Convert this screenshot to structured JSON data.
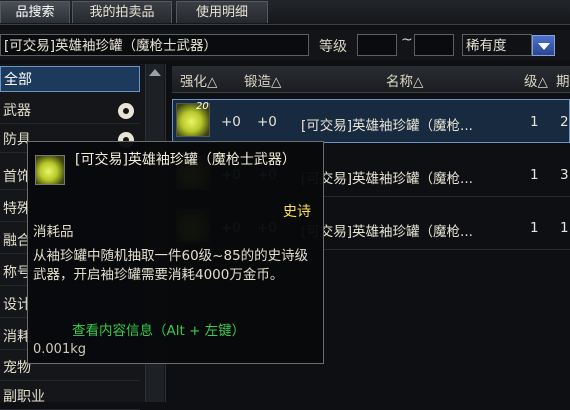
{
  "tabs": [
    "品搜索",
    "我的拍卖品",
    "使用明细"
  ],
  "search": {
    "item_query": "[可交易]英雄袖珍罐（魔枪士武器）",
    "level_label": "等级",
    "level_sep": "~",
    "rarity_label": "稀有度"
  },
  "sidebar": {
    "items": [
      {
        "label": "全部"
      },
      {
        "label": "武器"
      },
      {
        "label": "防具"
      },
      {
        "label": "首饰"
      },
      {
        "label": "特殊"
      },
      {
        "label": "融合"
      },
      {
        "label": "称号"
      },
      {
        "label": "设计"
      },
      {
        "label": "消耗"
      },
      {
        "label": "宠物"
      },
      {
        "label": "副职业"
      }
    ]
  },
  "table": {
    "headers": {
      "enhance": "强化△",
      "forge": "锻造△",
      "name": "名称△",
      "level": "级△",
      "period": "期"
    },
    "rows": [
      {
        "badge": "20",
        "enhance": "+0",
        "forge": "+0",
        "name": "[可交易]英雄袖珍罐（魔枪...",
        "level": "1",
        "period": "2"
      },
      {
        "badge": "",
        "enhance": "+0",
        "forge": "+0",
        "name": "[可交易]英雄袖珍罐（魔枪...",
        "level": "1",
        "period": "3"
      },
      {
        "badge": "",
        "enhance": "+0",
        "forge": "+0",
        "name": "[可交易]英雄袖珍罐（魔枪...",
        "level": "1",
        "period": "1"
      }
    ]
  },
  "tooltip": {
    "name": "[可交易]英雄袖珍罐（魔枪士武器）",
    "rarity": "史诗",
    "rarity_color": "#ffe14c",
    "type": "消耗品",
    "description": "从袖珍罐中随机抽取一件60级~85的的史诗级武器，开启袖珍罐需要消耗4000万金币。",
    "view_info": "查看内容信息（Alt + 左键）",
    "weight": "0.001kg"
  }
}
